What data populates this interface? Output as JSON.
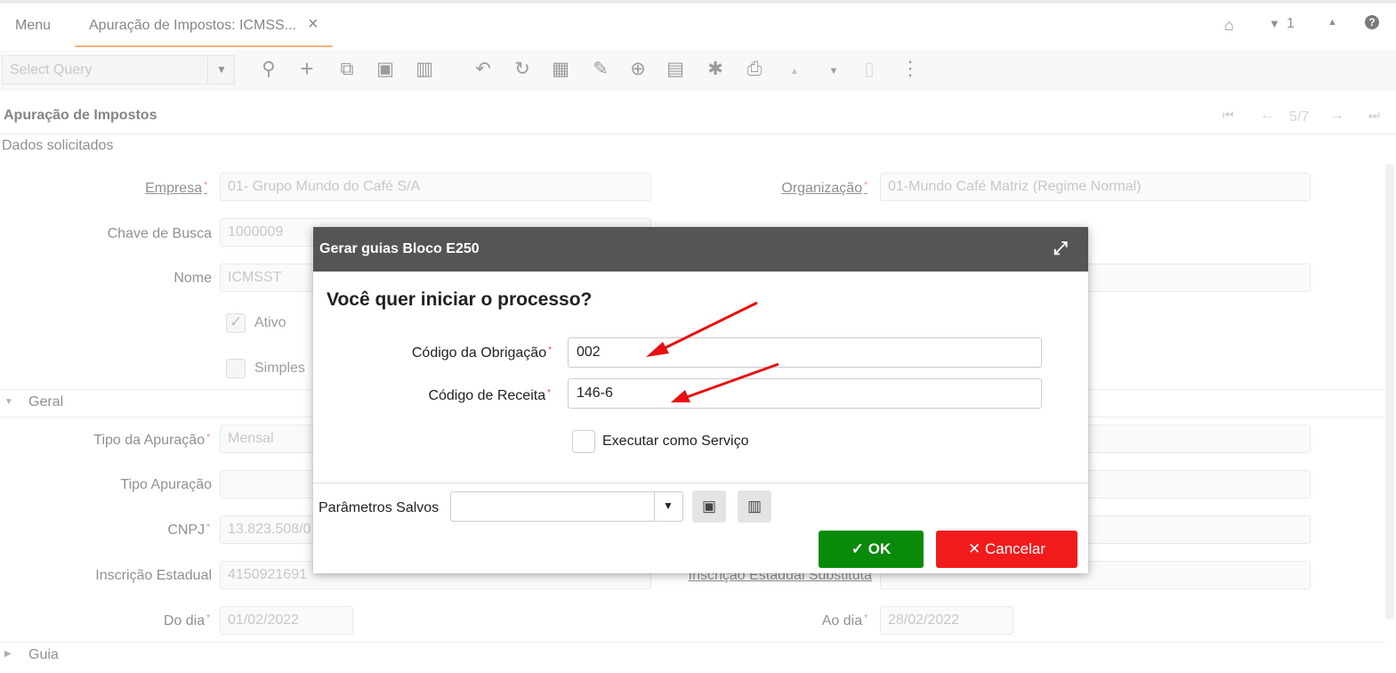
{
  "tabs": {
    "menu": "Menu",
    "active": "Apuração de Impostos: ICMSS...",
    "close": "×"
  },
  "topright": {
    "count": "1"
  },
  "toolbar": {
    "query_placeholder": "Select Query"
  },
  "section": {
    "title": "Apuração de Impostos",
    "pager": "5/7",
    "subtitle": "Dados solicitados"
  },
  "form": {
    "empresa_label": "Empresa",
    "empresa_value": "01- Grupo Mundo do Café S/A",
    "organizacao_label": "Organização",
    "organizacao_value": "01-Mundo Café Matriz (Regime Normal)",
    "chave_label": "Chave de Busca",
    "chave_value": "1000009",
    "nome_label": "Nome",
    "nome_value": "ICMSST",
    "ativo_label": "Ativo",
    "simples_label": "Simples",
    "geral_label": "Geral",
    "tipo_apuracao_label": "Tipo da Apuração",
    "tipo_apuracao_value": "Mensal",
    "tipo_apuracao2_label": "Tipo Apuração",
    "cnpj_label": "CNPJ",
    "cnpj_value": "13.823.508/0",
    "inscricao_label": "Inscrição Estadual",
    "inscricao_value": "4150921691",
    "inscricao_sub_label": "Inscrição Estadual Substituta",
    "do_dia_label": "Do dia",
    "do_dia_value": "01/02/2022",
    "ao_dia_label": "Ao dia",
    "ao_dia_value": "28/02/2022",
    "guia_label": "Guia"
  },
  "dialog": {
    "title": "Gerar guias Bloco E250",
    "question": "Você quer iniciar o processo?",
    "codigo_obrigacao_label": "Código da Obrigação",
    "codigo_obrigacao_value": "002",
    "codigo_receita_label": "Código de Receita",
    "codigo_receita_value": "146-6",
    "servico_label": "Executar como Serviço",
    "parametros_label": "Parâmetros Salvos",
    "ok_label": "OK",
    "cancel_label": "Cancelar"
  },
  "colors": {
    "tab_accent": "#f0892f",
    "dialog_header": "#555555",
    "ok_button": "#0a8a0a",
    "cancel_button": "#f21b1b",
    "arrow": "#e81010"
  },
  "icons": [
    "home-icon",
    "caret-down-icon",
    "caret-up-icon",
    "help-icon",
    "search-icon",
    "plus-icon",
    "copy-icon",
    "save-icon",
    "trash-icon",
    "undo-icon",
    "refresh-icon",
    "grid-icon",
    "attachment-icon",
    "zoom-icon",
    "report-icon",
    "gear-icon",
    "print-icon",
    "barcode-icon",
    "more-icon",
    "expand-icon",
    "check-icon",
    "close-icon"
  ]
}
